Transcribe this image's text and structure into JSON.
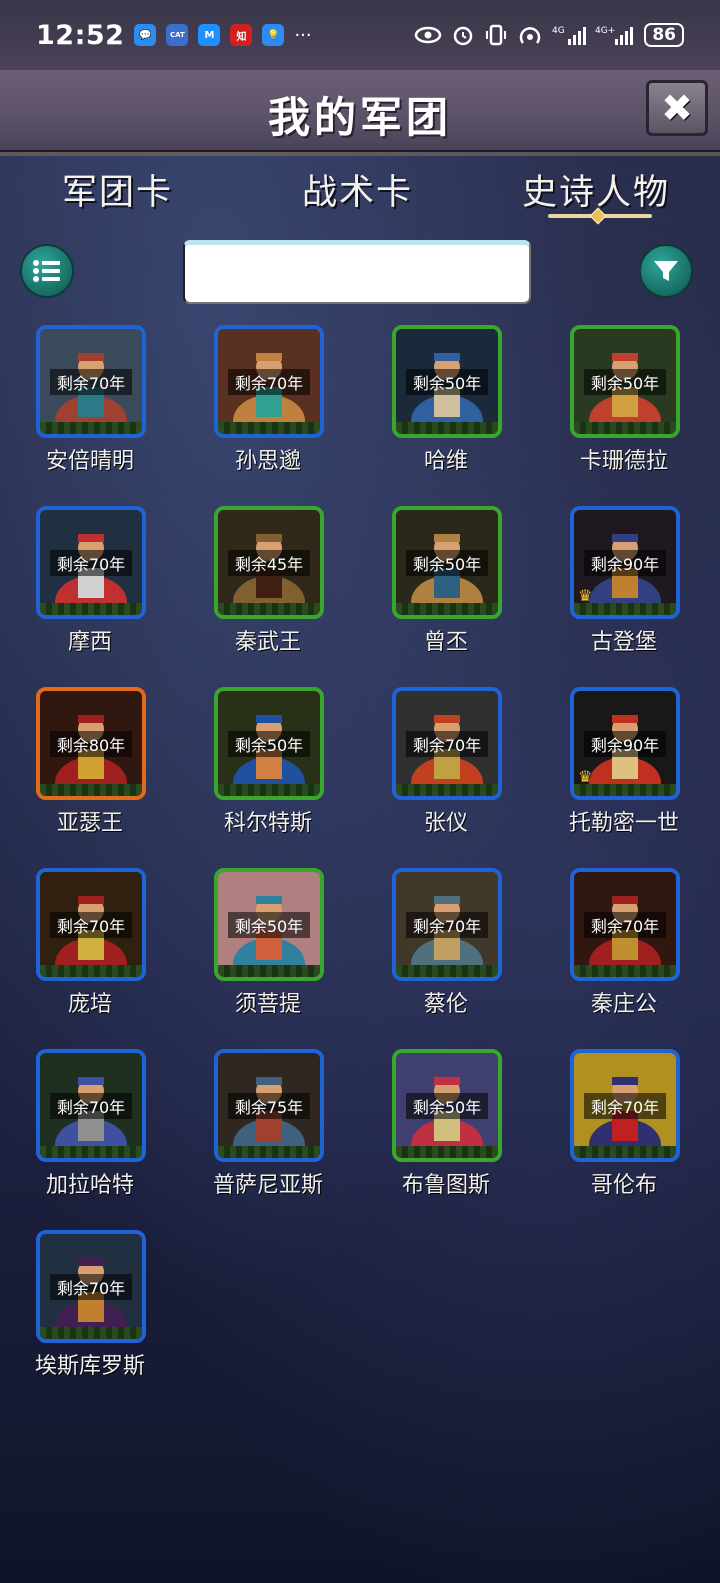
{
  "status": {
    "time": "12:52",
    "notifications": [
      {
        "icon": "chat-icon",
        "color": "#2d8cf0",
        "text": "💬"
      },
      {
        "icon": "catalink-icon",
        "color": "#3a6fd0",
        "text": "CAT"
      },
      {
        "icon": "m-app-icon",
        "color": "#1e90ff",
        "text": "M"
      },
      {
        "icon": "zhihu-icon",
        "color": "#d02020",
        "text": "知"
      },
      {
        "icon": "bulb-icon",
        "color": "#2d8cf0",
        "text": "💡"
      }
    ],
    "more": "···",
    "battery": "86"
  },
  "header": {
    "title": "我的军团",
    "close": "✖"
  },
  "tabs": [
    "军团卡",
    "战术卡",
    "史诗人物"
  ],
  "search": {
    "value": "",
    "placeholder": ""
  },
  "heroes": [
    {
      "name": "安倍晴明",
      "remain": "剩余70年",
      "frame": "blue"
    },
    {
      "name": "孙思邈",
      "remain": "剩余70年",
      "frame": "blue"
    },
    {
      "name": "哈维",
      "remain": "剩余50年",
      "frame": "green"
    },
    {
      "name": "卡珊德拉",
      "remain": "剩余50年",
      "frame": "green"
    },
    {
      "name": "摩西",
      "remain": "剩余70年",
      "frame": "blue"
    },
    {
      "name": "秦武王",
      "remain": "剩余45年",
      "frame": "green"
    },
    {
      "name": "曾丕",
      "remain": "剩余50年",
      "frame": "green"
    },
    {
      "name": "古登堡",
      "remain": "剩余90年",
      "frame": "blue",
      "crown": true
    },
    {
      "name": "亚瑟王",
      "remain": "剩余80年",
      "frame": "orange"
    },
    {
      "name": "科尔特斯",
      "remain": "剩余50年",
      "frame": "green"
    },
    {
      "name": "张仪",
      "remain": "剩余70年",
      "frame": "blue"
    },
    {
      "name": "托勒密一世",
      "remain": "剩余90年",
      "frame": "blue",
      "crown": true
    },
    {
      "name": "庞培",
      "remain": "剩余70年",
      "frame": "blue"
    },
    {
      "name": "须菩提",
      "remain": "剩余50年",
      "frame": "green"
    },
    {
      "name": "蔡伦",
      "remain": "剩余70年",
      "frame": "blue"
    },
    {
      "name": "秦庄公",
      "remain": "剩余70年",
      "frame": "blue"
    },
    {
      "name": "加拉哈特",
      "remain": "剩余70年",
      "frame": "blue"
    },
    {
      "name": "普萨尼亚斯",
      "remain": "剩余75年",
      "frame": "blue"
    },
    {
      "name": "布鲁图斯",
      "remain": "剩余50年",
      "frame": "green"
    },
    {
      "name": "哥伦布",
      "remain": "剩余70年",
      "frame": "blue"
    },
    {
      "name": "埃斯库罗斯",
      "remain": "剩余70年",
      "frame": "blue"
    }
  ],
  "colors": {
    "frame_blue": "#1f63d6",
    "frame_green": "#3aa62e",
    "frame_orange": "#e26a1a",
    "button_teal": "#186c63",
    "crown_gold": "#f2c22a"
  }
}
